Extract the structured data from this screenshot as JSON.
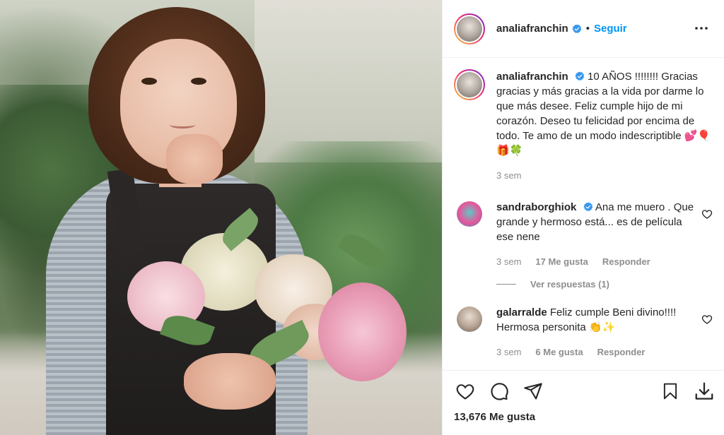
{
  "colors": {
    "accent": "#0095f6",
    "text": "#262626",
    "muted": "#8e8e8e",
    "border": "#efefef",
    "verified": "#3897f0"
  },
  "header": {
    "username": "analiafranchin",
    "separator": "•",
    "follow_label": "Seguir",
    "more_icon": "more-horizontal-icon"
  },
  "caption": {
    "username": "analiafranchin",
    "text": "10 AÑOS !!!!!!!! Gracias gracias y más gracias a la vida por darme lo que más desee. Feliz cumple hijo de mi corazón. Deseo tu felicidad por encima de todo. Te amo de un modo indescriptible 💕🎈🎁🍀",
    "time": "3 sem"
  },
  "comments": [
    {
      "username": "sandraborghiok",
      "verified": true,
      "text": "Ana me muero . Que grande y hermoso está... es de película ese nene",
      "time": "3 sem",
      "likes": "17 Me gusta",
      "reply_label": "Responder",
      "view_replies": "Ver respuestas (1)"
    },
    {
      "username": "galarralde",
      "verified": false,
      "text": "Feliz cumple Beni divino!!!! Hermosa personita 👏✨",
      "time": "3 sem",
      "likes": "6 Me gusta",
      "reply_label": "Responder"
    }
  ],
  "actions": {
    "like_icon": "heart-icon",
    "comment_icon": "comment-icon",
    "share_icon": "share-icon",
    "save_icon": "bookmark-icon",
    "download_icon": "download-icon"
  },
  "likes_count": "13,676 Me gusta"
}
